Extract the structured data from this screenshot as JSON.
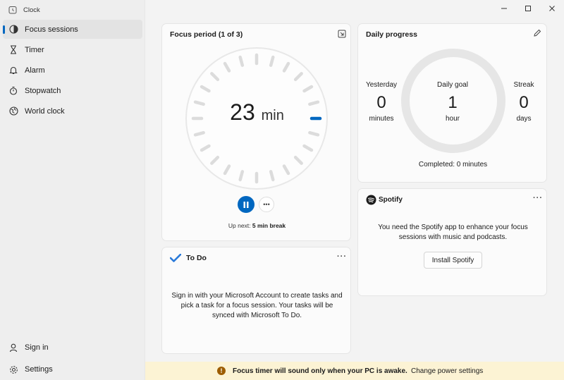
{
  "app": {
    "title": "Clock"
  },
  "sidebar": {
    "items": [
      {
        "label": "Focus sessions",
        "icon": "focus-icon",
        "active": true
      },
      {
        "label": "Timer",
        "icon": "hourglass-icon"
      },
      {
        "label": "Alarm",
        "icon": "bell-icon"
      },
      {
        "label": "Stopwatch",
        "icon": "stopwatch-icon"
      },
      {
        "label": "World clock",
        "icon": "globe-icon"
      }
    ],
    "bottom": [
      {
        "label": "Sign in",
        "icon": "person-icon"
      },
      {
        "label": "Settings",
        "icon": "gear-icon"
      }
    ]
  },
  "focus": {
    "title": "Focus period (1 of 3)",
    "time_value": "23",
    "time_unit": "min",
    "upnext_prefix": "Up next:",
    "upnext_value": "5 min break"
  },
  "progress": {
    "title": "Daily progress",
    "yesterday_label": "Yesterday",
    "yesterday_value": "0",
    "yesterday_unit": "minutes",
    "goal_label": "Daily goal",
    "goal_value": "1",
    "goal_unit": "hour",
    "streak_label": "Streak",
    "streak_value": "0",
    "streak_unit": "days",
    "completed": "Completed: 0 minutes"
  },
  "spotify": {
    "brand": "Spotify",
    "message": "You need the Spotify app to enhance your focus sessions with music and podcasts.",
    "install_label": "Install Spotify"
  },
  "todo": {
    "title": "To Do",
    "message": "Sign in with your Microsoft Account to create tasks and pick a task for a focus session. Your tasks will be synced with Microsoft To Do."
  },
  "banner": {
    "message": "Focus timer will sound only when your PC is awake.",
    "link": "Change power settings"
  },
  "colors": {
    "accent": "#0067c0",
    "banner_bg": "#fcf3d4",
    "warning": "#9d5d00"
  }
}
